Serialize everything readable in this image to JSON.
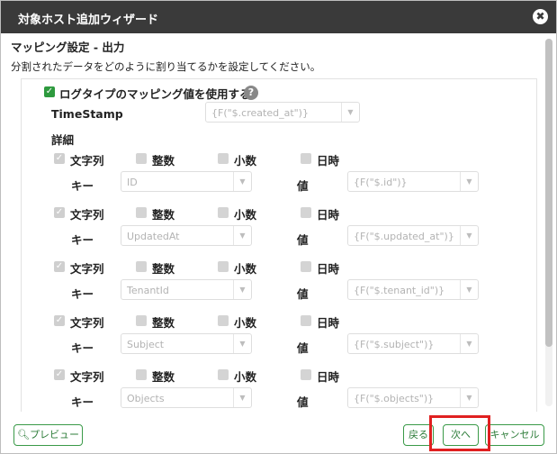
{
  "dialog": {
    "title": "対象ホスト追加ウィザード",
    "close_label": "✖"
  },
  "section": {
    "heading": "マッピング設定 - 出力",
    "description": "分割されたデータをどのように割り当てるかを設定してください。"
  },
  "log_type": {
    "label": "ログタイプのマッピング値を使用する",
    "checked": true,
    "help": "?"
  },
  "timestamp": {
    "label": "TimeStamp",
    "value": "{F(\"$.created_at\")}"
  },
  "details_label": "詳細",
  "type_labels": {
    "string": "文字列",
    "integer": "整数",
    "decimal": "小数",
    "datetime": "日時"
  },
  "key_label": "キー",
  "value_label": "値",
  "rows": [
    {
      "key": "ID",
      "value": "{F(\"$.id\")}"
    },
    {
      "key": "UpdatedAt",
      "value": "{F(\"$.updated_at\")}"
    },
    {
      "key": "TenantId",
      "value": "{F(\"$.tenant_id\")}"
    },
    {
      "key": "Subject",
      "value": "{F(\"$.subject\")}"
    },
    {
      "key": "Objects",
      "value": "{F(\"$.objects\")}"
    }
  ],
  "footer": {
    "preview_label": "プレビュー",
    "back_label": "戻る",
    "next_label": "次へ",
    "cancel_label": "キャンセル"
  },
  "colors": {
    "titlebar": "#3a3a3a",
    "accent_green": "#2e9a3e",
    "highlight_red": "#e02020"
  }
}
